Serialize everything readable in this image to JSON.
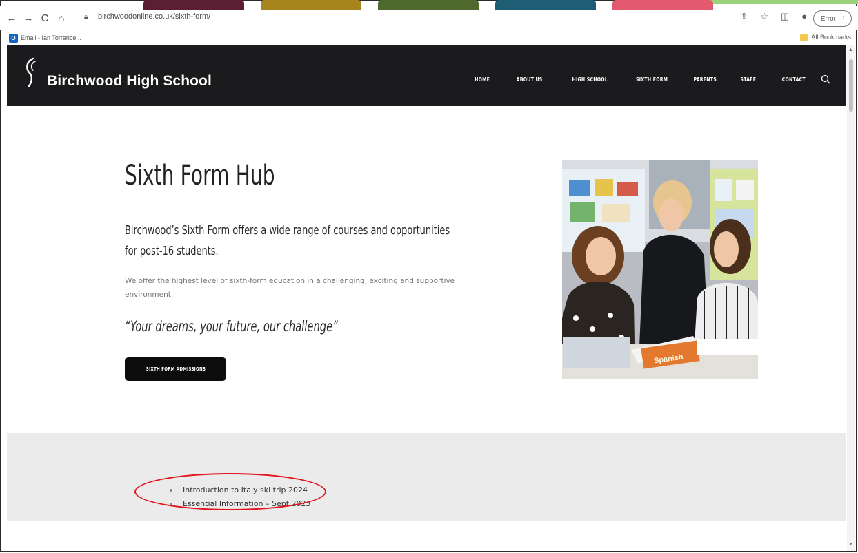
{
  "browser": {
    "url": "birchwoodonline.co.uk/sixth-form/",
    "error_label": "Error",
    "bookmarks": [
      {
        "label": "Email - Ian Torrance..."
      }
    ],
    "all_bookmarks_label": "All Bookmarks"
  },
  "site": {
    "name": "Birchwood High School",
    "nav": [
      "HOME",
      "ABOUT US",
      "HIGH SCHOOL",
      "SIXTH FORM",
      "PARENTS",
      "STAFF",
      "CONTACT"
    ]
  },
  "hero": {
    "title": "Sixth Form Hub",
    "lead": "Birchwood’s Sixth Form offers a wide range of courses and opportunities for post-16 students.",
    "body": "We offer the highest level of sixth-form education in a challenging, exciting and supportive environment.",
    "quote": "“Your dreams, your future, our challenge”",
    "cta_label": "SIXTH FORM ADMISSIONS",
    "photo_book_label": "Spanish"
  },
  "links": [
    {
      "label": "Introduction to Italy ski trip 2024"
    },
    {
      "label": "Essential Information – Sept 2023"
    }
  ],
  "tiles": {
    "colors": [
      "#5a1f33",
      "#a6861c",
      "#4f6a2c",
      "#1f5d74",
      "#e35a6e"
    ]
  },
  "colors": {
    "header_bg": "#1b1b1d",
    "annotation_red": "#e3141b",
    "band_bg": "#ebebeb"
  }
}
